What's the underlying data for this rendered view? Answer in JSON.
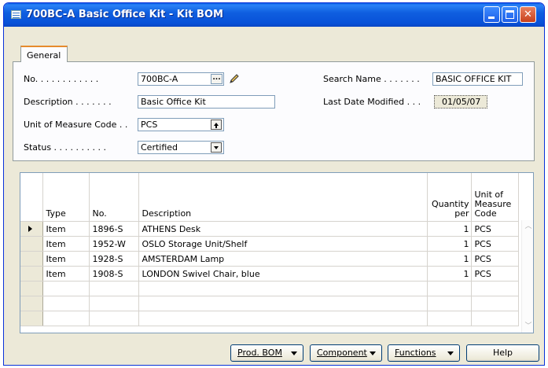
{
  "window": {
    "title": "700BC-A Basic Office Kit - Kit BOM",
    "icon": "table-window-icon"
  },
  "tabs": {
    "general": "General"
  },
  "form": {
    "no_label": "No. . . . . . . . . . . .",
    "no_value": "700BC-A",
    "description_label": "Description . . . . . . .",
    "description_value": "Basic Office Kit",
    "uom_label": "Unit of Measure Code . .",
    "uom_value": "PCS",
    "status_label": "Status . . . . . . . . . .",
    "status_value": "Certified",
    "search_name_label": "Search Name . . . . . . .",
    "search_name_value": "BASIC OFFICE KIT",
    "last_modified_label": "Last Date Modified . . .",
    "last_modified_value": "01/05/07",
    "lookup_glyph": "..."
  },
  "grid": {
    "headers": {
      "type": "Type",
      "no": "No.",
      "description": "Description",
      "quantity_line1": "Quantity",
      "quantity_line2": "per",
      "uom_line1": "Unit of",
      "uom_line2": "Measure",
      "uom_line3": "Code"
    },
    "rows": [
      {
        "type": "Item",
        "no": "1896-S",
        "description": "ATHENS Desk",
        "quantity": "1",
        "uom": "PCS"
      },
      {
        "type": "Item",
        "no": "1952-W",
        "description": "OSLO Storage Unit/Shelf",
        "quantity": "1",
        "uom": "PCS"
      },
      {
        "type": "Item",
        "no": "1928-S",
        "description": "AMSTERDAM Lamp",
        "quantity": "1",
        "uom": "PCS"
      },
      {
        "type": "Item",
        "no": "1908-S",
        "description": "LONDON Swivel Chair, blue",
        "quantity": "1",
        "uom": "PCS"
      }
    ]
  },
  "buttons": {
    "prod_bom": "Prod. BOM",
    "component": "Component",
    "functions": "Functions",
    "help": "Help"
  }
}
